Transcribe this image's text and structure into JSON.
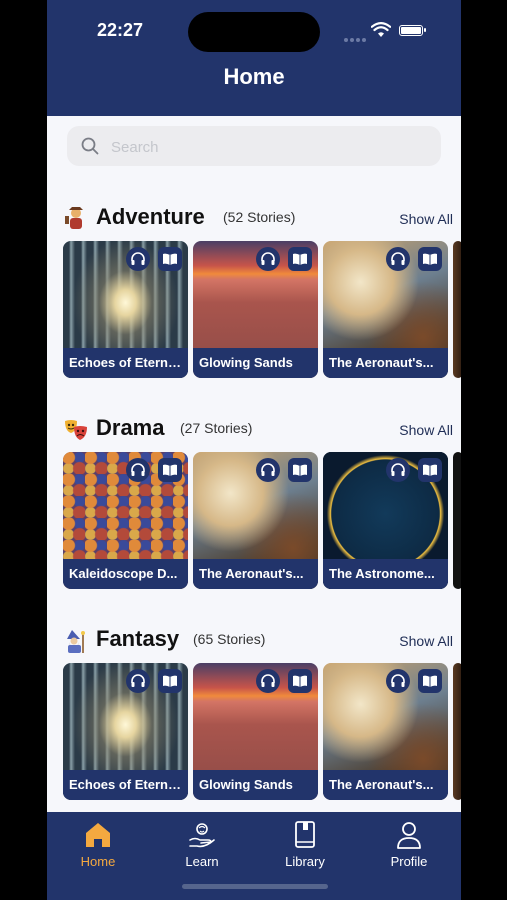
{
  "status_bar": {
    "time": "22:27"
  },
  "header": {
    "title": "Home"
  },
  "search": {
    "placeholder": "Search"
  },
  "sections": [
    {
      "name": "Adventure",
      "count": "(52 Stories)",
      "show_all": "Show All",
      "icon": "adventurer-icon",
      "cards": [
        "Echoes of Eterni...",
        "Glowing Sands",
        "The Aeronaut's..."
      ]
    },
    {
      "name": "Drama",
      "count": "(27 Stories)",
      "show_all": "Show All",
      "icon": "theater-masks-icon",
      "cards": [
        "Kaleidoscope D...",
        "The Aeronaut's...",
        "The Astronome..."
      ]
    },
    {
      "name": "Fantasy",
      "count": "(65 Stories)",
      "show_all": "Show All",
      "icon": "wizard-icon",
      "cards": [
        "Echoes of Eterni...",
        "Glowing Sands",
        "The Aeronaut's..."
      ]
    }
  ],
  "tabs": [
    {
      "label": "Home",
      "icon": "home-icon",
      "active": true
    },
    {
      "label": "Learn",
      "icon": "learn-icon",
      "active": false
    },
    {
      "label": "Library",
      "icon": "book-icon",
      "active": false
    },
    {
      "label": "Profile",
      "icon": "person-icon",
      "active": false
    }
  ],
  "colors": {
    "navy": "#22346b",
    "accent": "#f4a940",
    "background": "#f6f7fb"
  }
}
